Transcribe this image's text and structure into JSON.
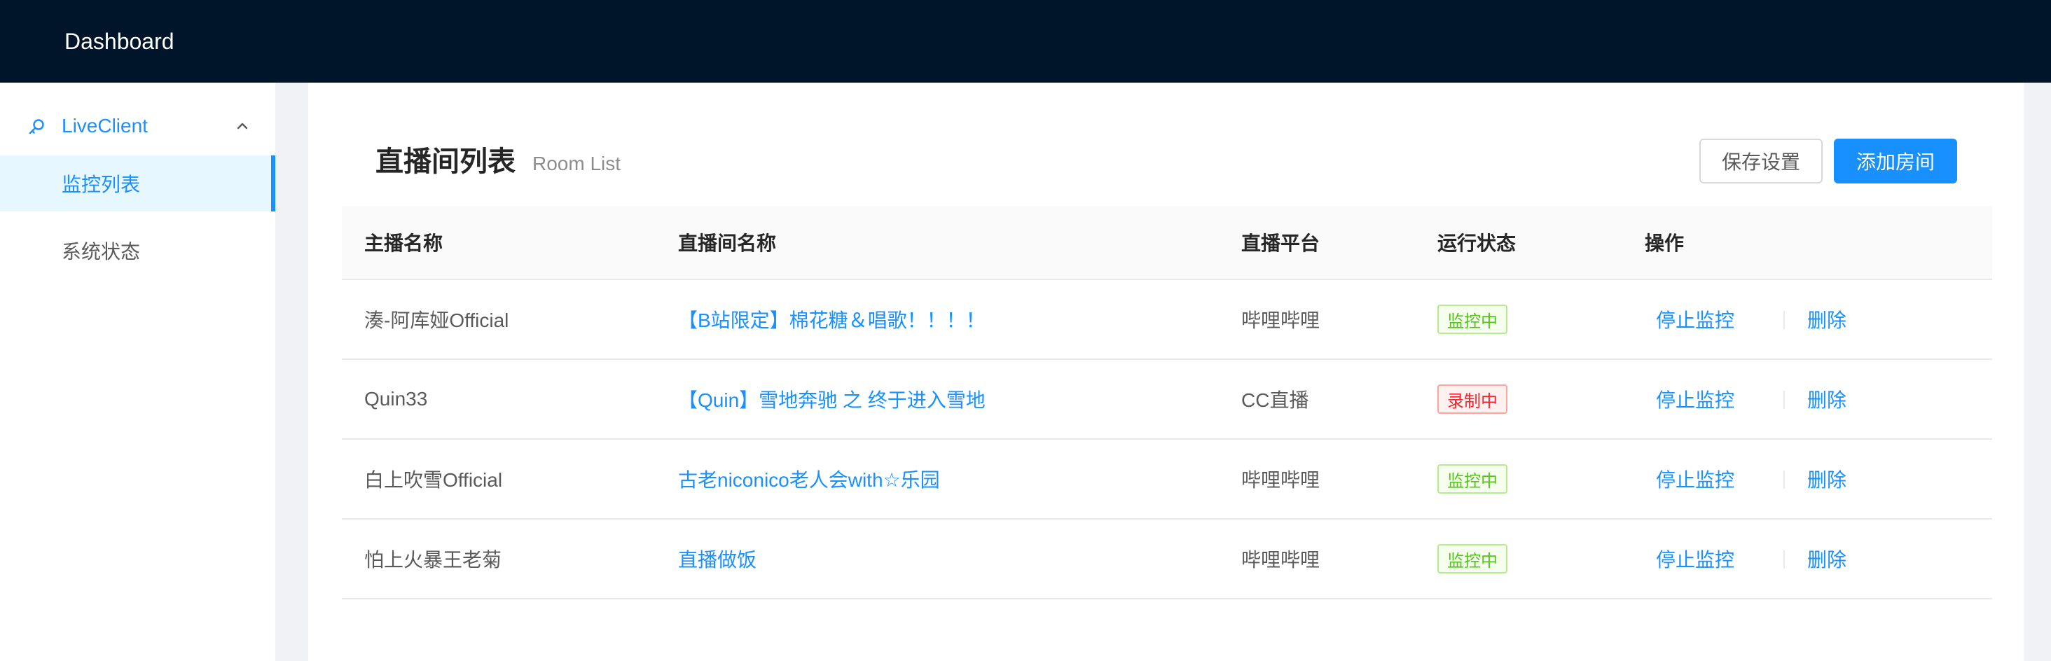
{
  "header": {
    "title": "Dashboard"
  },
  "sidebar": {
    "submenu": {
      "label": "LiveClient",
      "icon": "key-icon"
    },
    "items": [
      {
        "label": "监控列表",
        "active": true
      },
      {
        "label": "系统状态",
        "active": false
      }
    ]
  },
  "page": {
    "title": "直播间列表",
    "subtitle": "Room List",
    "save_button": "保存设置",
    "add_button": "添加房间"
  },
  "table": {
    "columns": [
      "主播名称",
      "直播间名称",
      "直播平台",
      "运行状态",
      "操作"
    ],
    "rows": [
      {
        "streamer": "湊-阿库娅Official",
        "room": "【B站限定】棉花糖＆唱歌！！！！",
        "platform": "哔哩哔哩",
        "status": "监控中",
        "status_color": "#52c41a",
        "action_stop": "停止监控",
        "action_delete": "删除"
      },
      {
        "streamer": "Quin33",
        "room": "【Quin】雪地奔驰 之 终于进入雪地",
        "platform": "CC直播",
        "status": "录制中",
        "status_color": "#f5222d",
        "action_stop": "停止监控",
        "action_delete": "删除"
      },
      {
        "streamer": "白上吹雪Official",
        "room": "古老niconico老人会with☆乐园",
        "platform": "哔哩哔哩",
        "status": "监控中",
        "status_color": "#52c41a",
        "action_stop": "停止监控",
        "action_delete": "删除"
      },
      {
        "streamer": "怕上火暴王老菊",
        "room": "直播做饭",
        "platform": "哔哩哔哩",
        "status": "监控中",
        "status_color": "#52c41a",
        "action_stop": "停止监控",
        "action_delete": "删除"
      }
    ]
  },
  "colors": {
    "header_bg": "#001529",
    "primary": "#1890ff",
    "active_menu_bg": "#e6f7ff"
  }
}
